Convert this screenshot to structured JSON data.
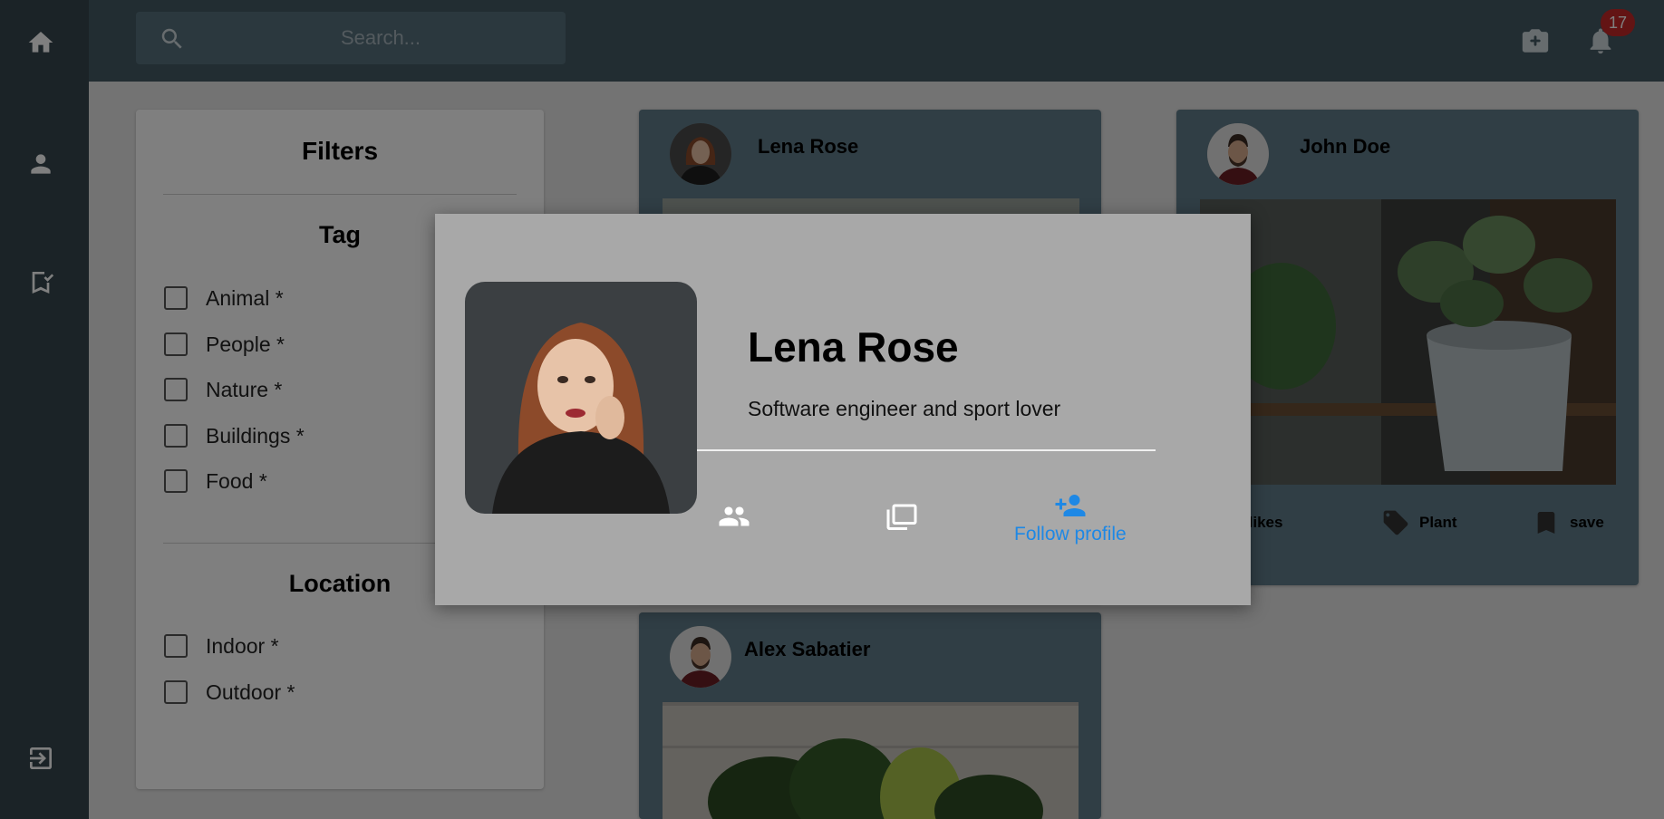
{
  "sidebar": {
    "items": [
      {
        "icon": "home-icon"
      },
      {
        "icon": "person-icon"
      },
      {
        "icon": "bookmark-check-icon"
      },
      {
        "icon": "logout-icon"
      }
    ]
  },
  "header": {
    "search_placeholder": "Search...",
    "notification_count": "17"
  },
  "filters": {
    "title": "Filters",
    "tag_section": {
      "title": "Tag",
      "options": [
        "Animal *",
        "People *",
        "Nature *",
        "Buildings *",
        "Food *"
      ]
    },
    "location_section": {
      "title": "Location",
      "options": [
        "Indoor *",
        "Outdoor *"
      ]
    }
  },
  "posts": [
    {
      "author": "Lena Rose"
    },
    {
      "author": "John Doe",
      "likes": "30 likes",
      "tag": "Plant",
      "save": "save"
    },
    {
      "author": "Alex Sabatier"
    }
  ],
  "modal": {
    "name": "Lena Rose",
    "bio": "Software engineer and sport lover",
    "follow_label": "Follow profile"
  },
  "colors": {
    "sidebar": "#37474f",
    "topbar": "#455a64",
    "card": "#607d8b",
    "badge": "#c62828",
    "accent": "#1e88e5"
  }
}
